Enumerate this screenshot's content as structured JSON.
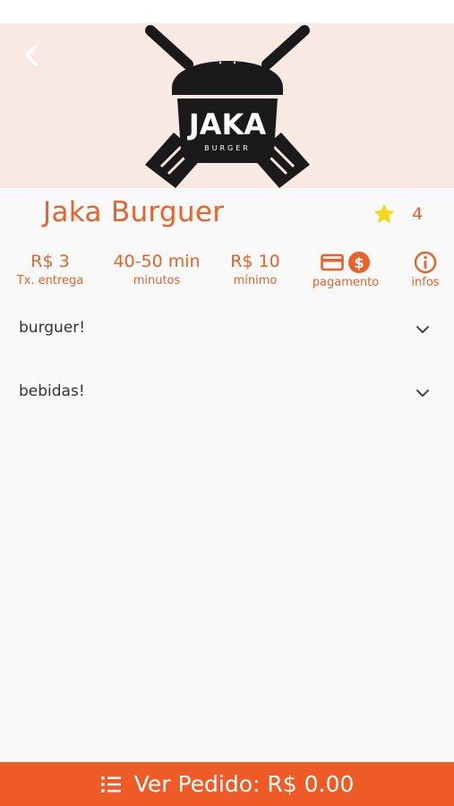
{
  "restaurant": {
    "name": "Jaka Burguer",
    "rating": "4",
    "logo_text": "JAKA",
    "logo_subtext": "BURGER"
  },
  "stats": [
    {
      "value": "R$ 3",
      "label": "Tx. entrega"
    },
    {
      "value": "40-50 min",
      "label": "minutos"
    },
    {
      "value": "R$ 10",
      "label": "mínimo"
    },
    {
      "label": "pagamento",
      "icon": "card-and-money-icon"
    },
    {
      "label": "infos",
      "icon": "info-icon"
    }
  ],
  "categories": [
    {
      "label": "burguer!"
    },
    {
      "label": "bebidas!"
    }
  ],
  "footer": {
    "label": "Ver Pedido: R$ 0.00"
  },
  "colors": {
    "accent": "#ee5b27",
    "hero_bg": "#f9e9e3",
    "star": "#f5d81e"
  }
}
